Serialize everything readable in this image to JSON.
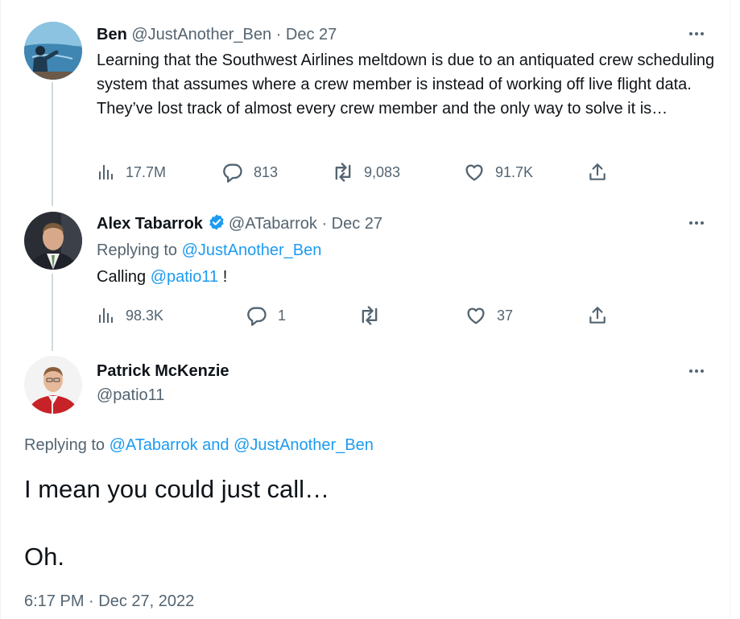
{
  "tweets": [
    {
      "name": "Ben",
      "handle": "@JustAnother_Ben",
      "separator": " · ",
      "date": "Dec 27",
      "text": "Learning that the Southwest Airlines meltdown is due to an antiquated crew scheduling system that assumes where a crew member is instead of working off live flight data. They’ve lost track of almost every crew member and the only way to solve it is…",
      "stats": {
        "views": "17.7M",
        "replies": "813",
        "retweets": "9,083",
        "likes": "91.7K"
      }
    },
    {
      "name": "Alex Tabarrok",
      "handle": "@ATabarrok",
      "separator": " · ",
      "date": "Dec 27",
      "replying_prefix": "Replying to ",
      "replying_to": "@JustAnother_Ben",
      "text_prefix": "Calling ",
      "mention": "@patio11",
      "text_suffix": " !",
      "stats": {
        "views": "98.3K",
        "replies": "1",
        "retweets": "",
        "likes": "37"
      }
    },
    {
      "name": "Patrick McKenzie",
      "handle": "@patio11",
      "replying_prefix": "Replying to ",
      "replying_to_1": "@ATabarrok",
      "replying_and": " and ",
      "replying_to_2": "@JustAnother_Ben",
      "line1": "I mean you could just call…",
      "line2": "Oh.",
      "timestamp": "6:17 PM · Dec 27, 2022"
    }
  ],
  "icons": [
    "views-icon",
    "reply-icon",
    "retweet-icon",
    "like-icon",
    "share-icon",
    "more-icon",
    "verified-badge-icon"
  ],
  "colors": {
    "link": "#1d9bf0",
    "secondary": "#536471",
    "text": "#0f1419",
    "thread_line": "#cfd9de",
    "verified": "#1d9bf0"
  }
}
